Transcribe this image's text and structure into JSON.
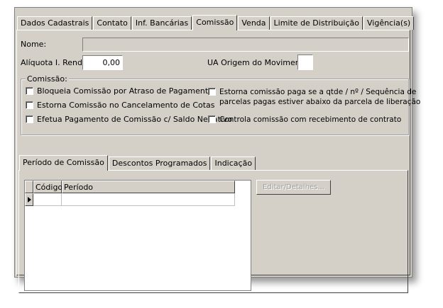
{
  "tabs": [
    {
      "label": "Dados Cadastrais",
      "active": false
    },
    {
      "label": "Contato",
      "active": false
    },
    {
      "label": "Inf. Bancárias",
      "active": false
    },
    {
      "label": "Comissão",
      "active": true
    },
    {
      "label": "Venda",
      "active": false
    },
    {
      "label": "Limite de Distribuição",
      "active": false
    },
    {
      "label": "Vigência(s)",
      "active": false
    }
  ],
  "form": {
    "nome_label": "Nome:",
    "nome_value": "",
    "aliquota_label": "Alíquota I. Renda:",
    "aliquota_value": "0,00",
    "ua_origem_label": "UA Origem do Movimento:",
    "ua_origem_value": ""
  },
  "comissao_group": {
    "title": "Comissão:",
    "checkboxes": [
      {
        "label": "Bloqueia Comissão por Atraso de Pagamento",
        "checked": false
      },
      {
        "label": "Estorna Comissão no Cancelamento de Cotas",
        "checked": false
      },
      {
        "label": "Efetua Pagamento de Comissão c/ Saldo Negativo",
        "checked": false
      },
      {
        "label_line1": "Estorna comissão paga se a qtde / nº / Sequência de",
        "label_line2": "parcelas pagas estiver abaixo da parcela de liberação",
        "checked": false
      },
      {
        "label": "Controla comissão com recebimento de contrato",
        "checked": false
      }
    ]
  },
  "subtabs": [
    {
      "label": "Período de Comissão",
      "active": true
    },
    {
      "label": "Descontos Programados",
      "active": false
    },
    {
      "label": "Indicação",
      "active": false
    }
  ],
  "grid": {
    "columns": [
      "Código",
      "Período"
    ],
    "rows": [
      [
        "",
        ""
      ]
    ]
  },
  "edit_button_label": "Editar/Detalhes..."
}
